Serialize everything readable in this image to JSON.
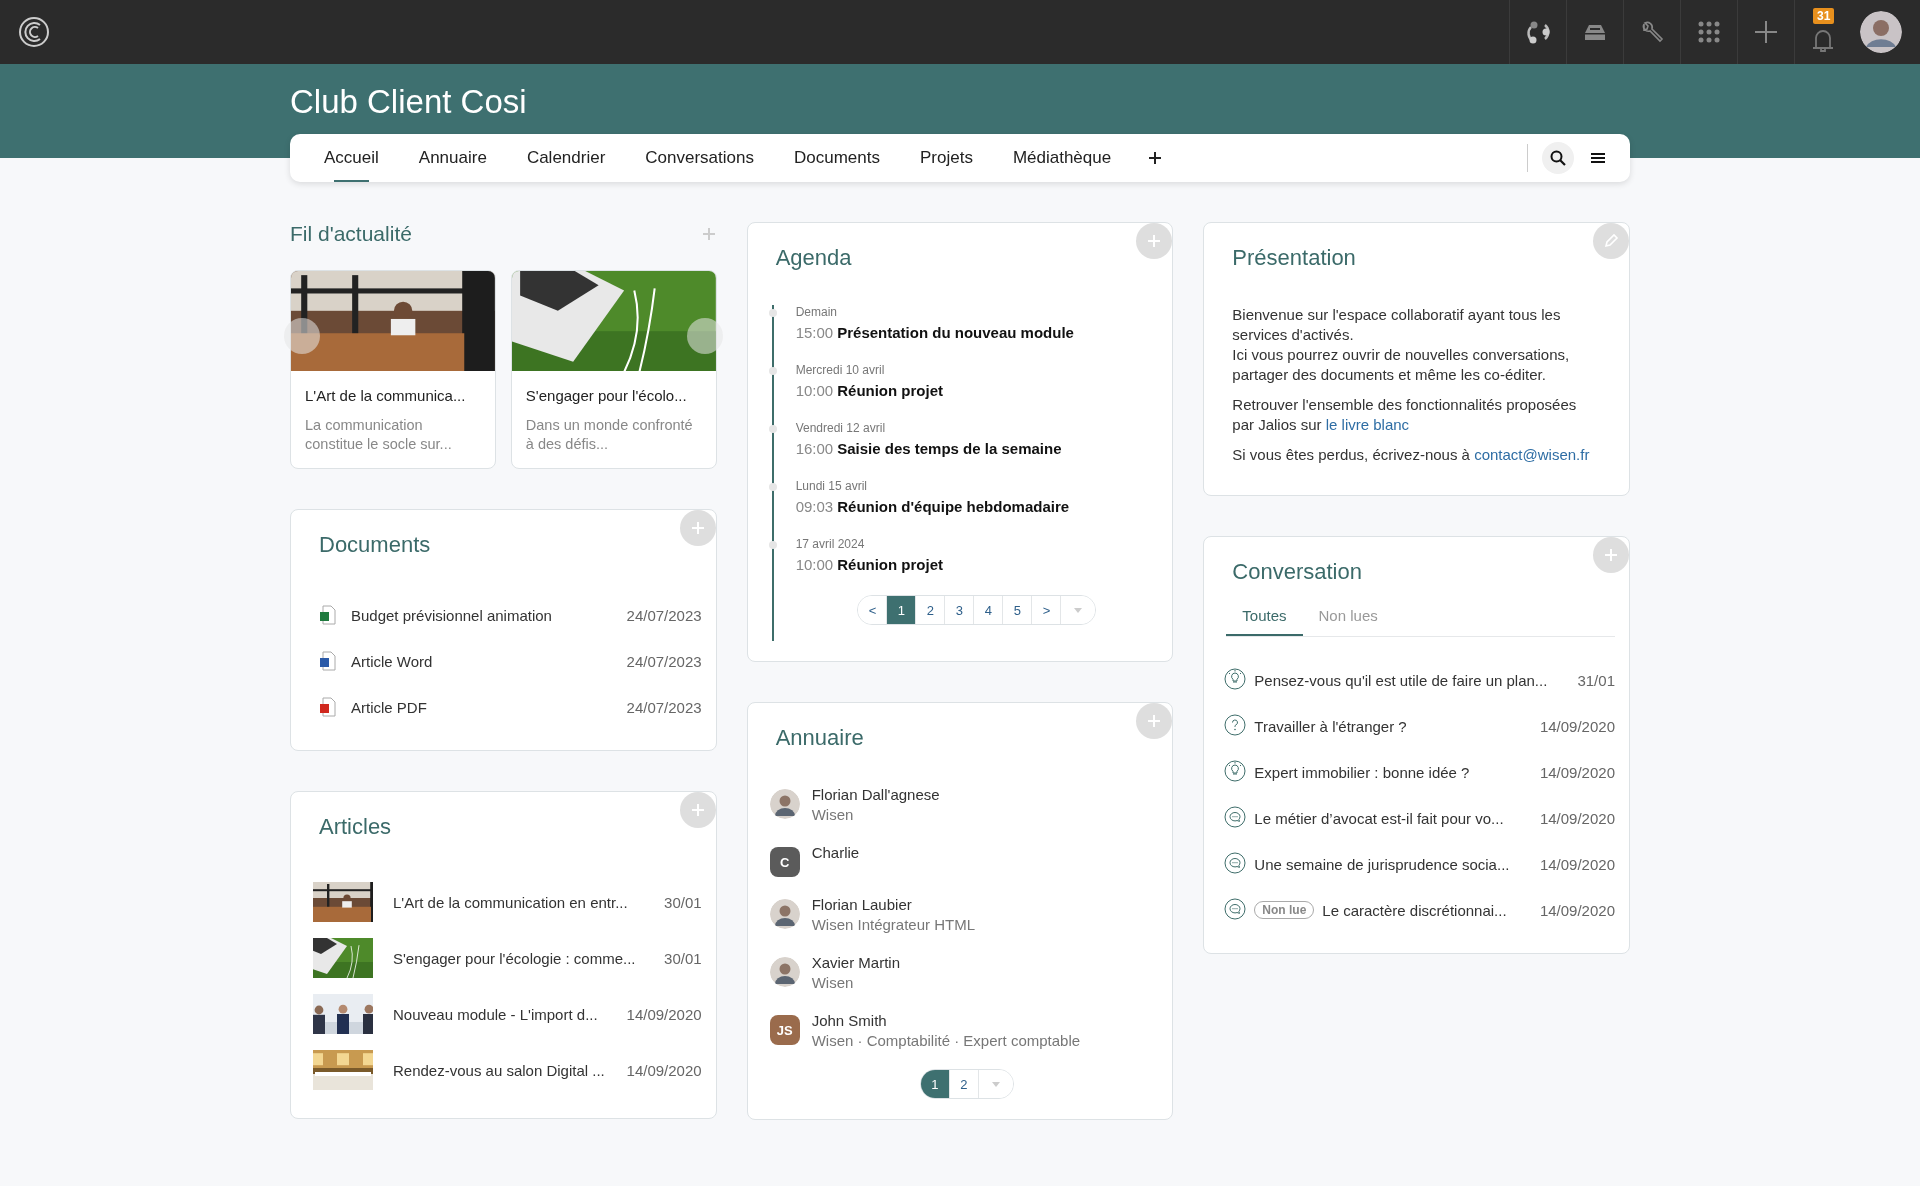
{
  "top_bar": {
    "notification_count": "31"
  },
  "space": {
    "title": "Club Client Cosi"
  },
  "nav": {
    "tabs": [
      {
        "label": "Accueil",
        "selected": true
      },
      {
        "label": "Annuaire",
        "selected": false
      },
      {
        "label": "Calendrier",
        "selected": false
      },
      {
        "label": "Conversations",
        "selected": false
      },
      {
        "label": "Documents",
        "selected": false
      },
      {
        "label": "Projets",
        "selected": false
      },
      {
        "label": "Médiathèque",
        "selected": false
      }
    ]
  },
  "news": {
    "title": "Fil d'actualité",
    "cards": [
      {
        "kind": "picture",
        "title": "L'Art de la communica...",
        "excerpt": "La communication constitue le socle sur..."
      },
      {
        "kind": "picture",
        "title": "S'engager pour l'écolo...",
        "excerpt": "Dans un monde confronté à des défis..."
      }
    ]
  },
  "documents": {
    "title": "Documents",
    "files": [
      {
        "kind": "excel",
        "name": "Budget prévisionnel animation",
        "date": "24/07/2023"
      },
      {
        "kind": "word",
        "name": "Article Word",
        "date": "24/07/2023"
      },
      {
        "kind": "pdf",
        "name": "Article PDF",
        "date": "24/07/2023"
      }
    ]
  },
  "articles": {
    "title": "Articles",
    "items": [
      {
        "kind": "picture",
        "title": "L'Art de la communication en entr...",
        "date": "30/01"
      },
      {
        "kind": "picture",
        "title": "S'engager pour l'écologie : comme...",
        "date": "30/01"
      },
      {
        "kind": "picture",
        "title": "Nouveau module - L'import d...",
        "date": "14/09/2020"
      },
      {
        "kind": "picture",
        "title": "Rendez-vous au salon Digital ...",
        "date": "14/09/2020"
      }
    ]
  },
  "agenda": {
    "title": "Agenda",
    "events": [
      {
        "day": "Demain",
        "time": "15:00",
        "title": "Présentation du nouveau module"
      },
      {
        "day": "Mercredi 10 avril",
        "time": "10:00",
        "title": "Réunion projet"
      },
      {
        "day": "Vendredi 12 avril",
        "time": "16:00",
        "title": "Saisie des temps de la semaine"
      },
      {
        "day": "Lundi 15 avril",
        "time": "09:03",
        "title": "Réunion d'équipe hebdomadaire"
      },
      {
        "day": "17 avril 2024",
        "time": "10:00",
        "title": "Réunion projet"
      }
    ],
    "pages": [
      {
        "label": "<",
        "selected": false
      },
      {
        "label": "1",
        "selected": true
      },
      {
        "label": "2",
        "selected": false
      },
      {
        "label": "3",
        "selected": false
      },
      {
        "label": "4",
        "selected": false
      },
      {
        "label": "5",
        "selected": false
      },
      {
        "label": ">",
        "selected": false
      }
    ]
  },
  "annuaire": {
    "title": "Annuaire",
    "people": [
      {
        "name": "Florian Dall'agnese",
        "detail": "Wisen"
      },
      {
        "kind": "initials",
        "initials": "C",
        "color": "#5b5b5b",
        "name": "Charlie"
      },
      {
        "name": "Florian Laubier",
        "detail": "Wisen Intégrateur HTML"
      },
      {
        "name": "Xavier Martin",
        "detail": "Wisen"
      },
      {
        "kind": "initials",
        "initials": "JS",
        "color": "#9a6b4c",
        "name": "John Smith",
        "detail": "Wisen · Comptabilité · Expert comptable"
      }
    ],
    "pages": [
      {
        "label": "1",
        "selected": true
      },
      {
        "label": "2",
        "selected": false
      }
    ]
  },
  "presentation": {
    "title": "Présentation",
    "paragraphs": [
      {
        "parts": [
          {
            "kind": "text",
            "text": "Bienvenue sur l'espace collaboratif ayant tous les services d'activés."
          },
          {
            "kind": "break"
          },
          {
            "kind": "text",
            "text": "Ici vous pourrez ouvrir de nouvelles conversations, partager des documents et même les co-éditer."
          }
        ]
      },
      {
        "parts": [
          {
            "kind": "text",
            "text": "Retrouver l'ensemble des fonctionnalités proposées par Jalios sur "
          },
          {
            "kind": "link",
            "text": "le livre blanc"
          }
        ]
      },
      {
        "parts": [
          {
            "kind": "text",
            "text": "Si vous êtes perdus, écrivez-nous à "
          },
          {
            "kind": "link",
            "text": "contact@wisen.fr"
          }
        ]
      }
    ]
  },
  "conversation": {
    "title": "Conversation",
    "tabs": [
      {
        "label": "Toutes",
        "selected": true
      },
      {
        "label": "Non lues",
        "selected": false
      }
    ],
    "threads": [
      {
        "kind": "idea",
        "title": "Pensez-vous qu'il est utile de faire un plan...",
        "date": "31/01"
      },
      {
        "kind": "question",
        "title": "Travailler à l'étranger ?",
        "date": "14/09/2020"
      },
      {
        "kind": "idea",
        "title": "Expert immobilier : bonne idée ?",
        "date": "14/09/2020"
      },
      {
        "kind": "chat",
        "title": "Le métier d’avocat est-il fait pour vo...",
        "date": "14/09/2020"
      },
      {
        "kind": "chat",
        "title": "Une semaine de jurisprudence socia...",
        "date": "14/09/2020"
      },
      {
        "kind": "chat",
        "badge": "Non lue",
        "title": "Le caractère discrétionnai...",
        "date": "14/09/2020"
      }
    ]
  }
}
